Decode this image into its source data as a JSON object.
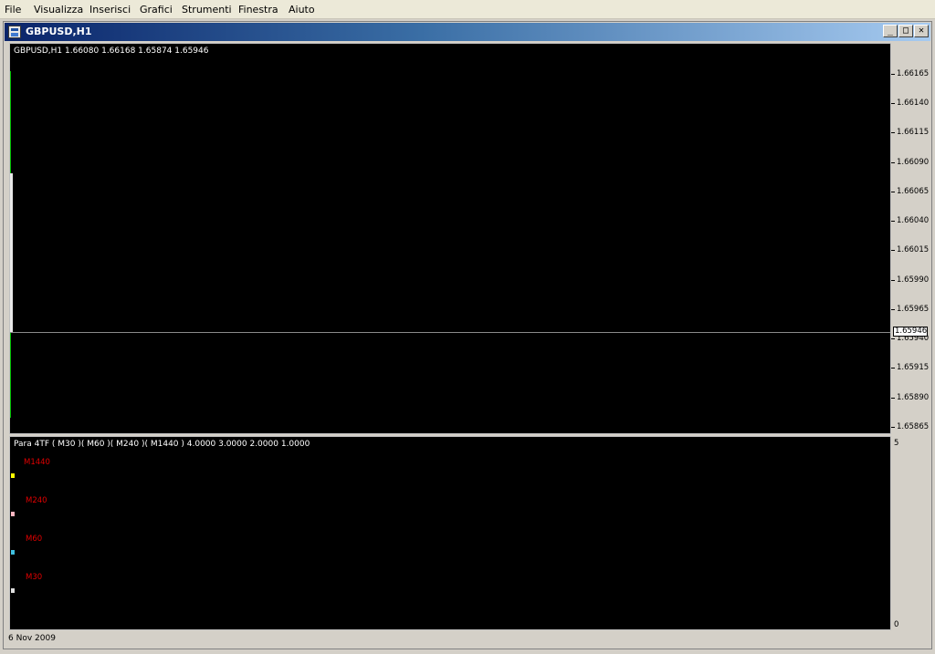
{
  "menu": {
    "items": [
      "File",
      "Visualizza",
      "Inserisci",
      "Grafici",
      "Strumenti",
      "Finestra",
      "Aiuto"
    ]
  },
  "window": {
    "title": "GBPUSD,H1",
    "minimize_glyph": "_",
    "maximize_glyph": "□",
    "close_glyph": "✕"
  },
  "main_pane": {
    "label": "GBPUSD,H1  1.66080 1.66168 1.65874 1.65946",
    "current_price": "1.65946",
    "price_scale": [
      "1.66165",
      "1.66140",
      "1.66115",
      "1.66090",
      "1.66065",
      "1.66040",
      "1.66015",
      "1.65990",
      "1.65965",
      "1.65940",
      "1.65915",
      "1.65890",
      "1.65865"
    ]
  },
  "indicator_pane": {
    "label": "Para 4TF ( M30 )( M60 )( M240 )( M1440 ) 4.0000 3.0000 2.0000 1.0000",
    "scale_top": "5",
    "scale_bottom": "0",
    "timeframes": [
      {
        "name": "M1440",
        "color": "#ffff00"
      },
      {
        "name": "M240",
        "color": "#ffb6c1"
      },
      {
        "name": "M60",
        "color": "#40c0e0"
      },
      {
        "name": "M30",
        "color": "#e0e0e0"
      }
    ]
  },
  "time_axis": {
    "start_date": "6 Nov 2009"
  },
  "colors": {
    "background": "#000000",
    "bull_wick": "#00c000",
    "indicator_text": "#e00000"
  }
}
